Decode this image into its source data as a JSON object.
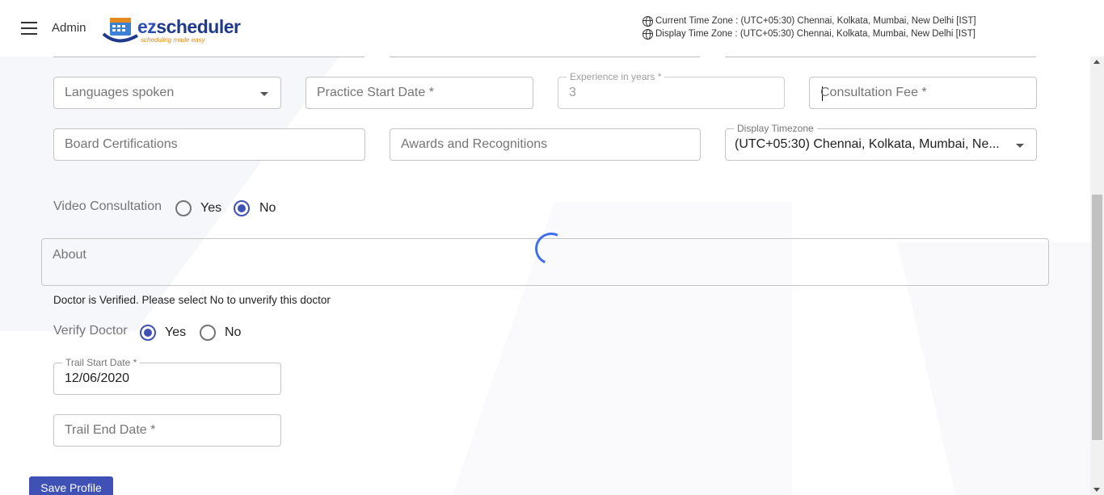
{
  "header": {
    "admin_label": "Admin",
    "logo_text_prefix": "ez",
    "logo_text_suffix": "scheduler",
    "logo_tagline": "scheduling made easy",
    "current_tz": "Current Time Zone : (UTC+05:30) Chennai, Kolkata, Mumbai, New Delhi [IST]",
    "display_tz": "Display Time Zone : (UTC+05:30) Chennai, Kolkata, Mumbai, New Delhi [IST]"
  },
  "form": {
    "languages_placeholder": "Languages spoken",
    "practice_start_placeholder": "Practice Start Date *",
    "experience_label": "Experience in years *",
    "experience_value": "3",
    "consultation_fee_placeholder": "Consultation Fee  *",
    "board_cert_placeholder": "Board Certifications",
    "awards_placeholder": "Awards and Recognitions",
    "display_timezone_label": "Display Timezone",
    "display_timezone_value": "(UTC+05:30) Chennai, Kolkata, Mumbai, Ne...",
    "video_consultation_label": "Video Consultation",
    "video_yes": "Yes",
    "video_no": "No",
    "video_selected": "No",
    "about_placeholder": "About",
    "verified_note": "Doctor is Verified. Please select No to unverify this doctor",
    "verify_label": "Verify Doctor",
    "verify_yes": "Yes",
    "verify_no": "No",
    "verify_selected": "Yes",
    "trail_start_label": "Trail Start Date *",
    "trail_start_value": "12/06/2020",
    "trail_end_placeholder": "Trail End Date *",
    "save_label": "Save Profile"
  },
  "colors": {
    "accent": "#3f51b5",
    "spinner": "#3f6ee8"
  }
}
